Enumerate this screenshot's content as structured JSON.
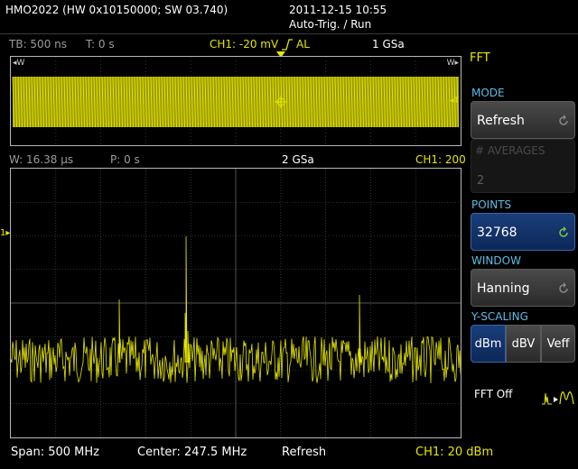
{
  "header": {
    "device_info": "HMO2022 (HW 0x10150000; SW 03.740)",
    "datetime": "2011-12-15 10:55",
    "trigger_status": "Auto-Trig. / Run"
  },
  "status": {
    "timebase": "TB: 500 ns",
    "time_offset": "T: 0 s",
    "trigger_info": "CH1: -20 mV",
    "trigger_mode": "AL",
    "sample_rate": "1 GSa"
  },
  "overview": {
    "left_marker": "W",
    "right_marker": "W",
    "trigger_marker": "T"
  },
  "zoom_status": {
    "window_width": "W: 16.38 µs",
    "position": "P: 0 s",
    "sample_rate": "2 GSa",
    "channel_scale": "CH1: 200"
  },
  "fft": {
    "channel_marker": "1",
    "trace_color": "#e6e600",
    "grid_color": "#555555"
  },
  "sidebar": {
    "title": "FFT",
    "mode": {
      "label": "MODE",
      "value": "Refresh"
    },
    "averages": {
      "label": "# AVERAGES",
      "value": "2"
    },
    "points": {
      "label": "POINTS",
      "value": "32768"
    },
    "window": {
      "label": "WINDOW",
      "value": "Hanning"
    },
    "y_scaling": {
      "label": "Y-SCALING",
      "options": [
        "dBm",
        "dBV",
        "Veff"
      ],
      "selected": "dBm"
    },
    "fft_off_label": "FFT Off"
  },
  "footer": {
    "span": "Span: 500 MHz",
    "center": "Center: 247.5 MHz",
    "mode": "Refresh",
    "channel_scale": "CH1: 20 dBm"
  }
}
